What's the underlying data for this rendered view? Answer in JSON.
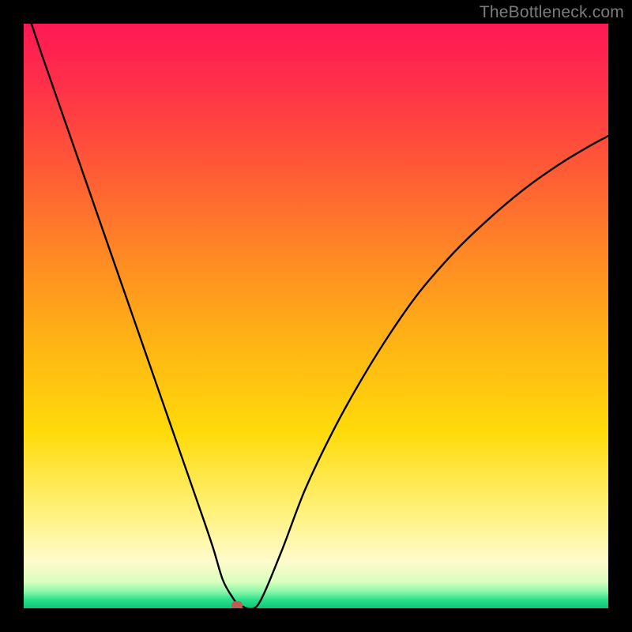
{
  "attribution": "TheBottleneck.com",
  "chart_data": {
    "type": "line",
    "title": "",
    "xlabel": "",
    "ylabel": "",
    "xlim": [
      0,
      100
    ],
    "ylim": [
      0,
      100
    ],
    "x": [
      0,
      3,
      7,
      11,
      15,
      19,
      23,
      27,
      31,
      32.5,
      34,
      35.5,
      37,
      40,
      44,
      48,
      53,
      58,
      63,
      68,
      74,
      80,
      86,
      92,
      97,
      100
    ],
    "values": [
      104,
      95,
      83.5,
      72,
      60.5,
      49,
      37.5,
      26,
      14.5,
      10,
      5,
      2.2,
      0.5,
      0.5,
      9.5,
      20,
      30.5,
      39.5,
      47.5,
      54.5,
      61.3,
      67,
      72,
      76.2,
      79.2,
      80.8
    ],
    "min_point": {
      "x": 36.5,
      "y": 0.5
    },
    "gradient_colors": {
      "top": "#ff1854",
      "mid_upper": "#ff8a24",
      "mid": "#ffdb0a",
      "mid_lower": "#fff280",
      "bottom": "#0bc679"
    }
  }
}
